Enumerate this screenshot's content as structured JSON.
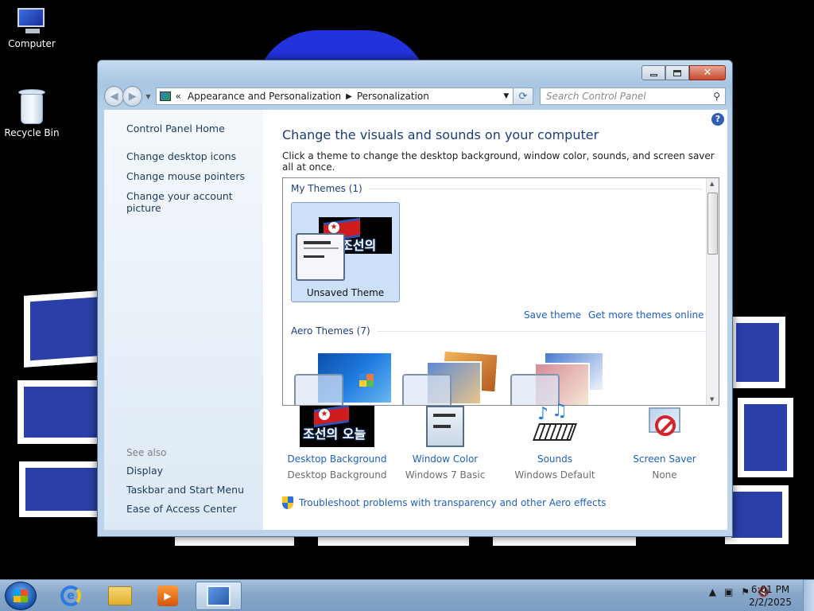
{
  "desktop": {
    "icons": [
      {
        "label": "Computer"
      },
      {
        "label": "Recycle Bin"
      }
    ]
  },
  "window": {
    "controls": {
      "minimize": "_",
      "maximize": "□",
      "close": "✕"
    },
    "navigation": {
      "back": "◀",
      "forward": "▶",
      "breadcrumb_prefix": "«",
      "breadcrumbs": [
        "Appearance and Personalization",
        "Personalization"
      ],
      "search_placeholder": "Search Control Panel",
      "search_icon": "search-icon"
    },
    "sidebar": {
      "home": "Control Panel Home",
      "links": [
        "Change desktop icons",
        "Change mouse pointers",
        "Change your account picture"
      ],
      "see_also_header": "See also",
      "see_also": [
        "Display",
        "Taskbar and Start Menu",
        "Ease of Access Center"
      ]
    },
    "main": {
      "help": "?",
      "title": "Change the visuals and sounds on your computer",
      "subtitle": "Click a theme to change the desktop background, window color, sounds, and screen saver all at once.",
      "my_themes_header": "My Themes (1)",
      "selected_theme": {
        "name": "Unsaved Theme",
        "banner_text": "조선의 오늘"
      },
      "save_theme": "Save theme",
      "get_more": "Get more themes online",
      "aero_themes_header": "Aero Themes (7)",
      "options": [
        {
          "label": "Desktop Background",
          "value": "Desktop Background"
        },
        {
          "label": "Window Color",
          "value": "Windows 7 Basic"
        },
        {
          "label": "Sounds",
          "value": "Windows Default"
        },
        {
          "label": "Screen Saver",
          "value": "None"
        }
      ],
      "troubleshoot": "Troubleshoot problems with transparency and other Aero effects"
    }
  },
  "taskbar": {
    "clock_time": "6:01 PM",
    "clock_date": "2/2/2025",
    "tray_icons": [
      "show-hidden-icon",
      "network-icon",
      "action-center-flag-icon",
      "volume-muted-icon"
    ],
    "tray_glyphs": {
      "show_hidden": "▲",
      "network": "▣",
      "flag": "⚑",
      "volume": "🔇"
    },
    "pinned": [
      "internet-explorer",
      "windows-explorer",
      "media-player",
      "control-panel"
    ]
  },
  "colors": {
    "accent_link": "#1f5fbd",
    "window_frame": "#b4cfe8",
    "close_button": "#c74a2f",
    "taskbar": "#86a6c8"
  }
}
